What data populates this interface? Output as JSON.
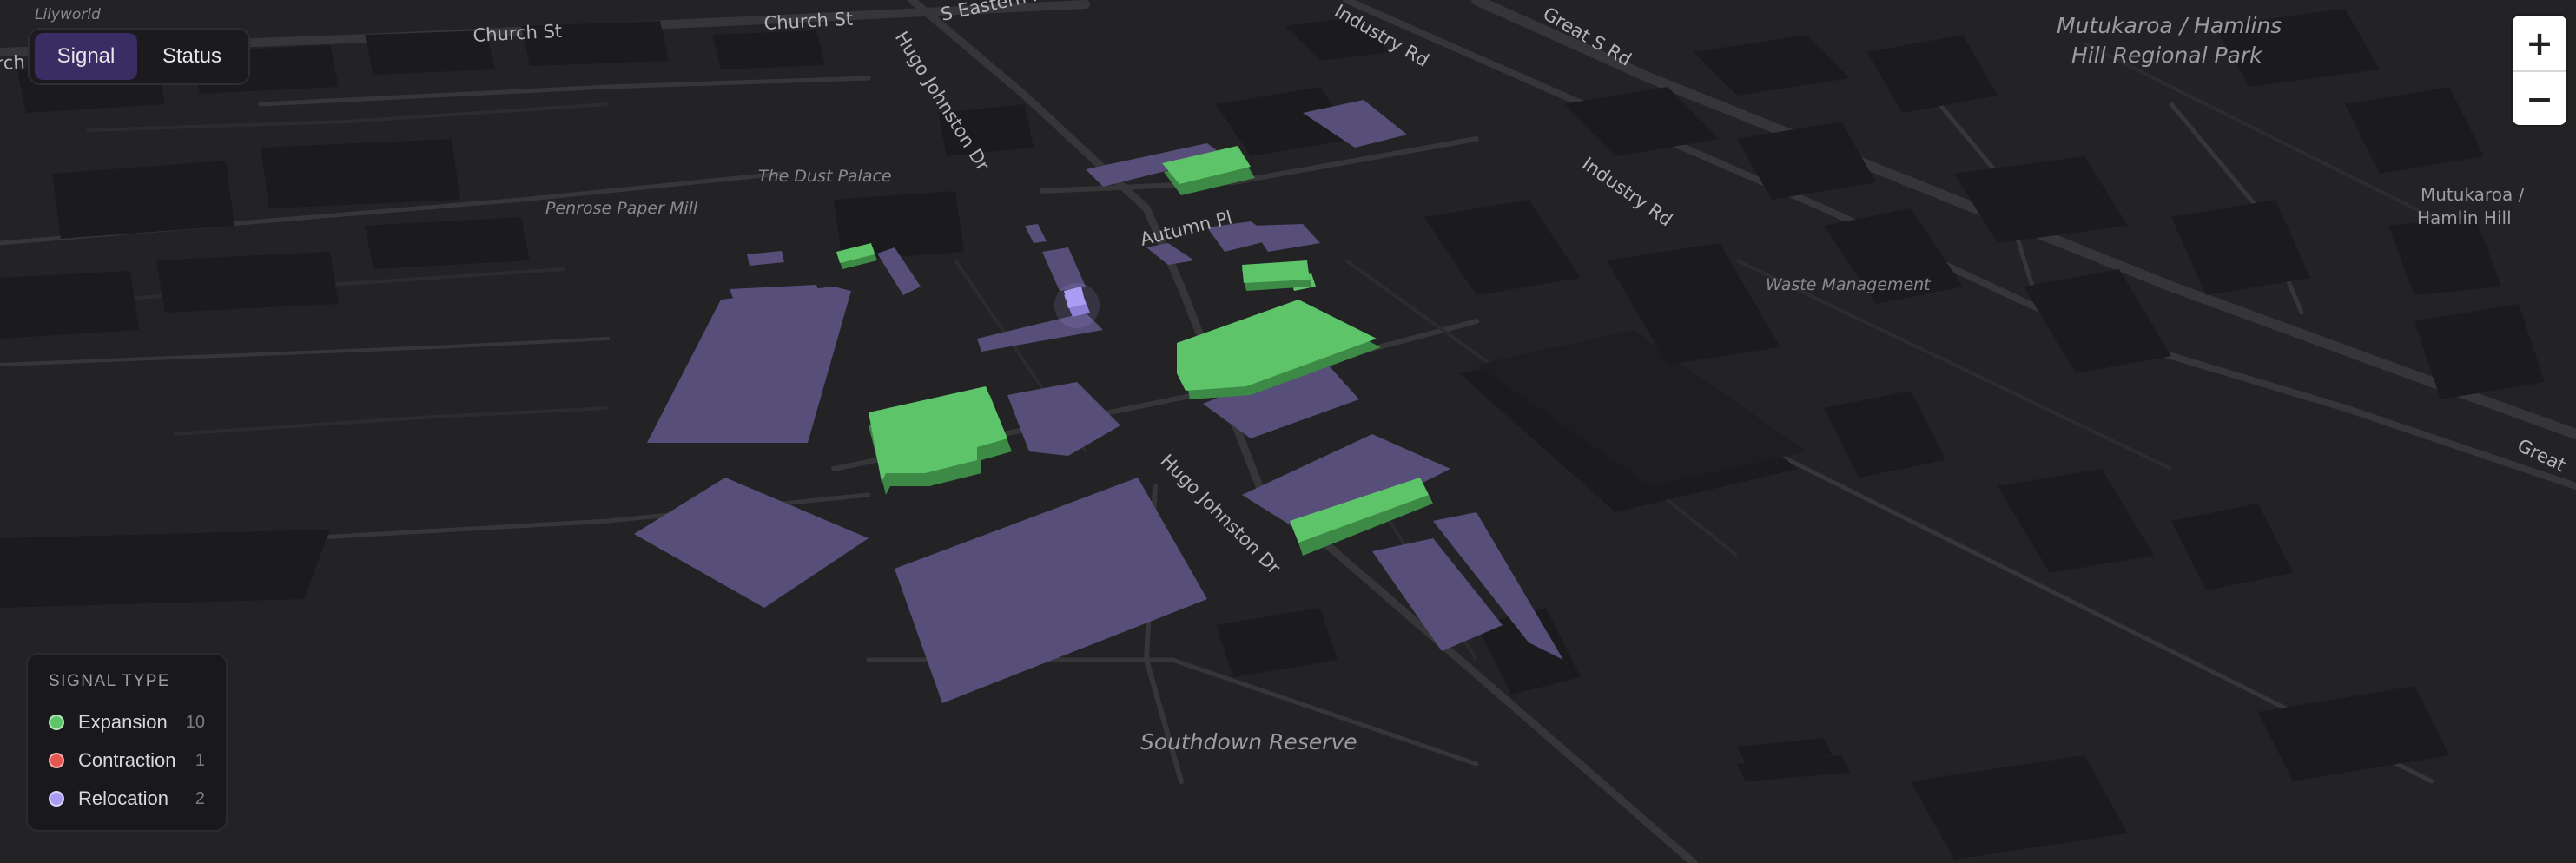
{
  "map": {
    "road_labels": [
      "Church St",
      "Church St",
      "S Eastern Hwy",
      "Hugo Johnston Dr",
      "Industry Rd",
      "Great S Rd",
      "Industry Rd",
      "Autumn Pl",
      "Hugo Johnston Dr",
      "Great"
    ],
    "place_labels": [
      "Lilyworld",
      "The Dust Palace",
      "Penrose Paper Mill",
      "Waste Management"
    ],
    "park_labels": [
      "Mutukaroa / Hamlins",
      "Hill Regional Park",
      "Southdown Reserve"
    ],
    "area_labels": [
      "Mutukaroa /",
      "Hamlin Hill"
    ],
    "partial_label": "rch"
  },
  "view_toggle": {
    "options": [
      "Signal",
      "Status"
    ],
    "selected": "Signal"
  },
  "zoom": {
    "in_label": "+",
    "out_label": "−"
  },
  "legend": {
    "title": "SIGNAL TYPE",
    "items": [
      {
        "label": "Expansion",
        "count": "10",
        "color": "#5ec46a"
      },
      {
        "label": "Contraction",
        "count": "1",
        "color": "#e5564e"
      },
      {
        "label": "Relocation",
        "count": "2",
        "color": "#a99cf2"
      }
    ]
  },
  "colors": {
    "background": "#232325",
    "road": "#343437",
    "building": "#1b1b1d",
    "parcel": "#574e7a",
    "expansion_building": "#5ec46a",
    "relocation_building": "#a99cf2"
  }
}
